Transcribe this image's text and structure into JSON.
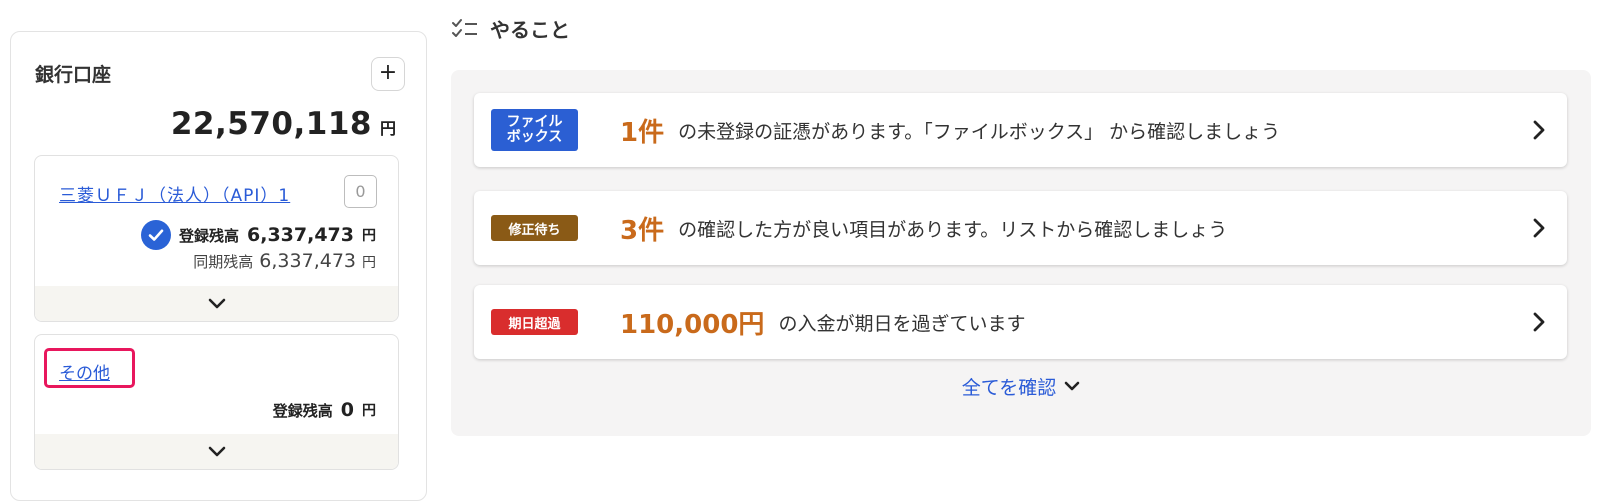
{
  "bank": {
    "title": "銀行口座",
    "add_label": "+",
    "total_amount": "22,570,118",
    "currency": "円",
    "accounts": [
      {
        "name": "三菱ＵＦＪ（法人）（API）1",
        "badge": "0",
        "registered_label": "登録残高",
        "registered_amount": "6,337,473",
        "sync_label": "同期残高",
        "sync_amount": "6,337,473",
        "unit": "円"
      },
      {
        "name": "その他",
        "registered_label": "登録残高",
        "registered_amount": "0",
        "unit": "円"
      }
    ]
  },
  "todo": {
    "title": "やること",
    "items": [
      {
        "tag": "ファイル\nボックス",
        "value": "1件",
        "text": "の未登録の証憑があります。「ファイルボックス」 から確認しましょう"
      },
      {
        "tag": "修正待ち",
        "value": "3件",
        "text": "の確認した方が良い項目があります。リストから確認しましょう"
      },
      {
        "tag": "期日超過",
        "value": "110,000円",
        "text": "の入金が期日を過ぎています"
      }
    ],
    "see_all": "全てを確認"
  },
  "colors": {
    "link": "#2a5bd7",
    "check": "#2a63d6",
    "highlight": "#e8175d",
    "tag_file": "#2b5fd3",
    "tag_fix": "#8a5a16",
    "tag_overdue": "#d92d2d",
    "value": "#c96a1b"
  },
  "icons": [
    "checklist-icon",
    "check-circle-icon",
    "chevron-down-icon",
    "chevron-right-icon",
    "plus-icon"
  ]
}
